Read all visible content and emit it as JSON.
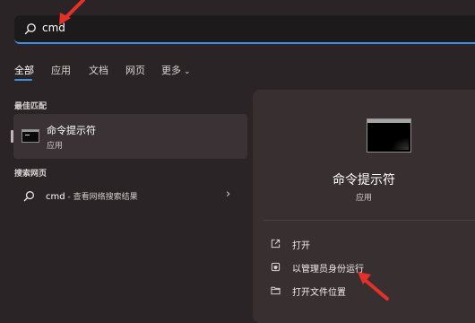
{
  "search": {
    "value": "cmd",
    "icon": "search-icon"
  },
  "tabs": [
    {
      "label": "全部",
      "active": true
    },
    {
      "label": "应用"
    },
    {
      "label": "文档"
    },
    {
      "label": "网页"
    },
    {
      "label": "更多"
    }
  ],
  "best_match": {
    "section_label": "最佳匹配",
    "title": "命令提示符",
    "subtitle": "应用",
    "icon": "command-prompt-icon"
  },
  "web_search": {
    "section_label": "搜索网页",
    "query": "cmd",
    "hint": " - 查看网络搜索结果",
    "icon": "search-icon",
    "arrow": "›"
  },
  "details": {
    "title": "命令提示符",
    "subtitle": "应用",
    "icon": "command-prompt-icon",
    "actions": [
      {
        "label": "打开",
        "icon": "open-icon"
      },
      {
        "label": "以管理员身份运行",
        "icon": "shield-icon"
      },
      {
        "label": "打开文件位置",
        "icon": "folder-icon"
      }
    ]
  },
  "colors": {
    "accent": "#3f8fe0",
    "annotation": "#e5302a",
    "background": "#2b2426"
  }
}
